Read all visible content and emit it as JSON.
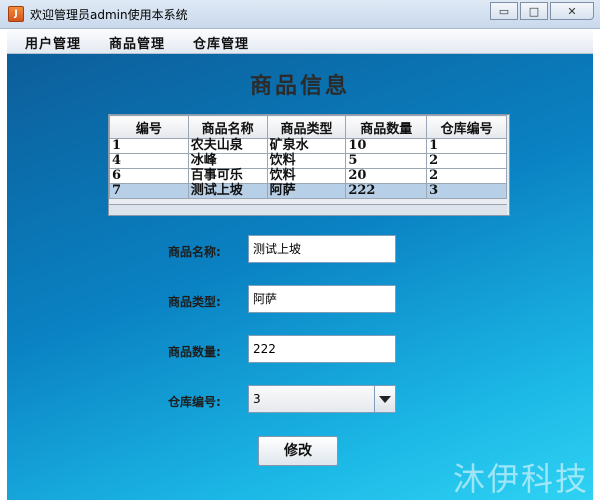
{
  "window": {
    "title": "欢迎管理员admin使用本系统",
    "icon_letter": "J",
    "minimize_glyph": "▭",
    "maximize_glyph": "□",
    "close_glyph": "✕"
  },
  "menu": {
    "items": [
      {
        "label": "用户管理"
      },
      {
        "label": "商品管理"
      },
      {
        "label": "仓库管理"
      }
    ]
  },
  "panel": {
    "title": "商品信息"
  },
  "table": {
    "headers": [
      "编号",
      "商品名称",
      "商品类型",
      "商品数量",
      "仓库编号"
    ],
    "rows": [
      {
        "cells": [
          "1",
          "农夫山泉",
          "矿泉水",
          "10",
          "1"
        ],
        "selected": false
      },
      {
        "cells": [
          "4",
          "冰峰",
          "饮料",
          "5",
          "2"
        ],
        "selected": false
      },
      {
        "cells": [
          "6",
          "百事可乐",
          "饮料",
          "20",
          "2"
        ],
        "selected": false
      },
      {
        "cells": [
          "7",
          "测试上坡",
          "阿萨",
          "222",
          "3"
        ],
        "selected": true
      }
    ]
  },
  "form": {
    "name_label": "商品名称:",
    "name_value": "测试上坡",
    "type_label": "商品类型:",
    "type_value": "阿萨",
    "quantity_label": "商品数量:",
    "quantity_value": "222",
    "warehouse_label": "仓库编号:",
    "warehouse_value": "3",
    "submit_label": "修改"
  },
  "watermark": "沐伊科技",
  "colors": {
    "selected_row": "#b8cfe8",
    "panel_gradient_start": "#0c5e9a",
    "panel_gradient_end": "#2fd2f3"
  }
}
